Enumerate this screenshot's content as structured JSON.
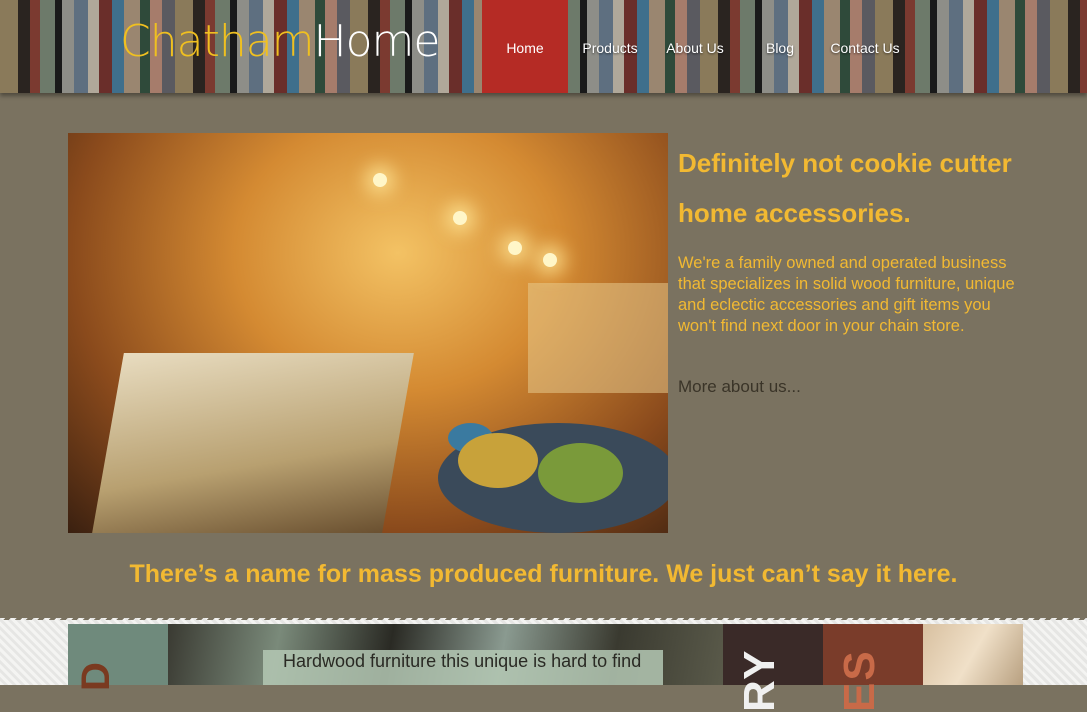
{
  "logo": {
    "part1": "Chatham",
    "part2": "Home"
  },
  "nav": {
    "items": [
      {
        "label": "Home",
        "active": true
      },
      {
        "label": "Products",
        "active": false
      },
      {
        "label": "About Us",
        "active": false
      },
      {
        "label": "Blog",
        "active": false
      },
      {
        "label": "Contact Us",
        "active": false
      }
    ]
  },
  "hero": {
    "image_desc": "bedroom-with-hot-air-balloon-lamps-photo"
  },
  "about": {
    "headline": "Definitely not cookie cutter home accessories.",
    "intro": "We're a family owned and operated business that specializes in solid wood furniture, unique and eclectic accessories and gift items you won't find next door in your chain store.",
    "more_link": "More about us..."
  },
  "tagline": "There’s a name for mass produced furniture. We just can’t say it here.",
  "lower": {
    "caption": "Hardwood furniture this unique is hard to find",
    "strip_text_1": "D",
    "strip_text_3": "RY",
    "strip_text_4": "ES"
  },
  "colors": {
    "accent": "#f2b932",
    "active_nav": "#b52b25",
    "background": "#7a7260"
  }
}
